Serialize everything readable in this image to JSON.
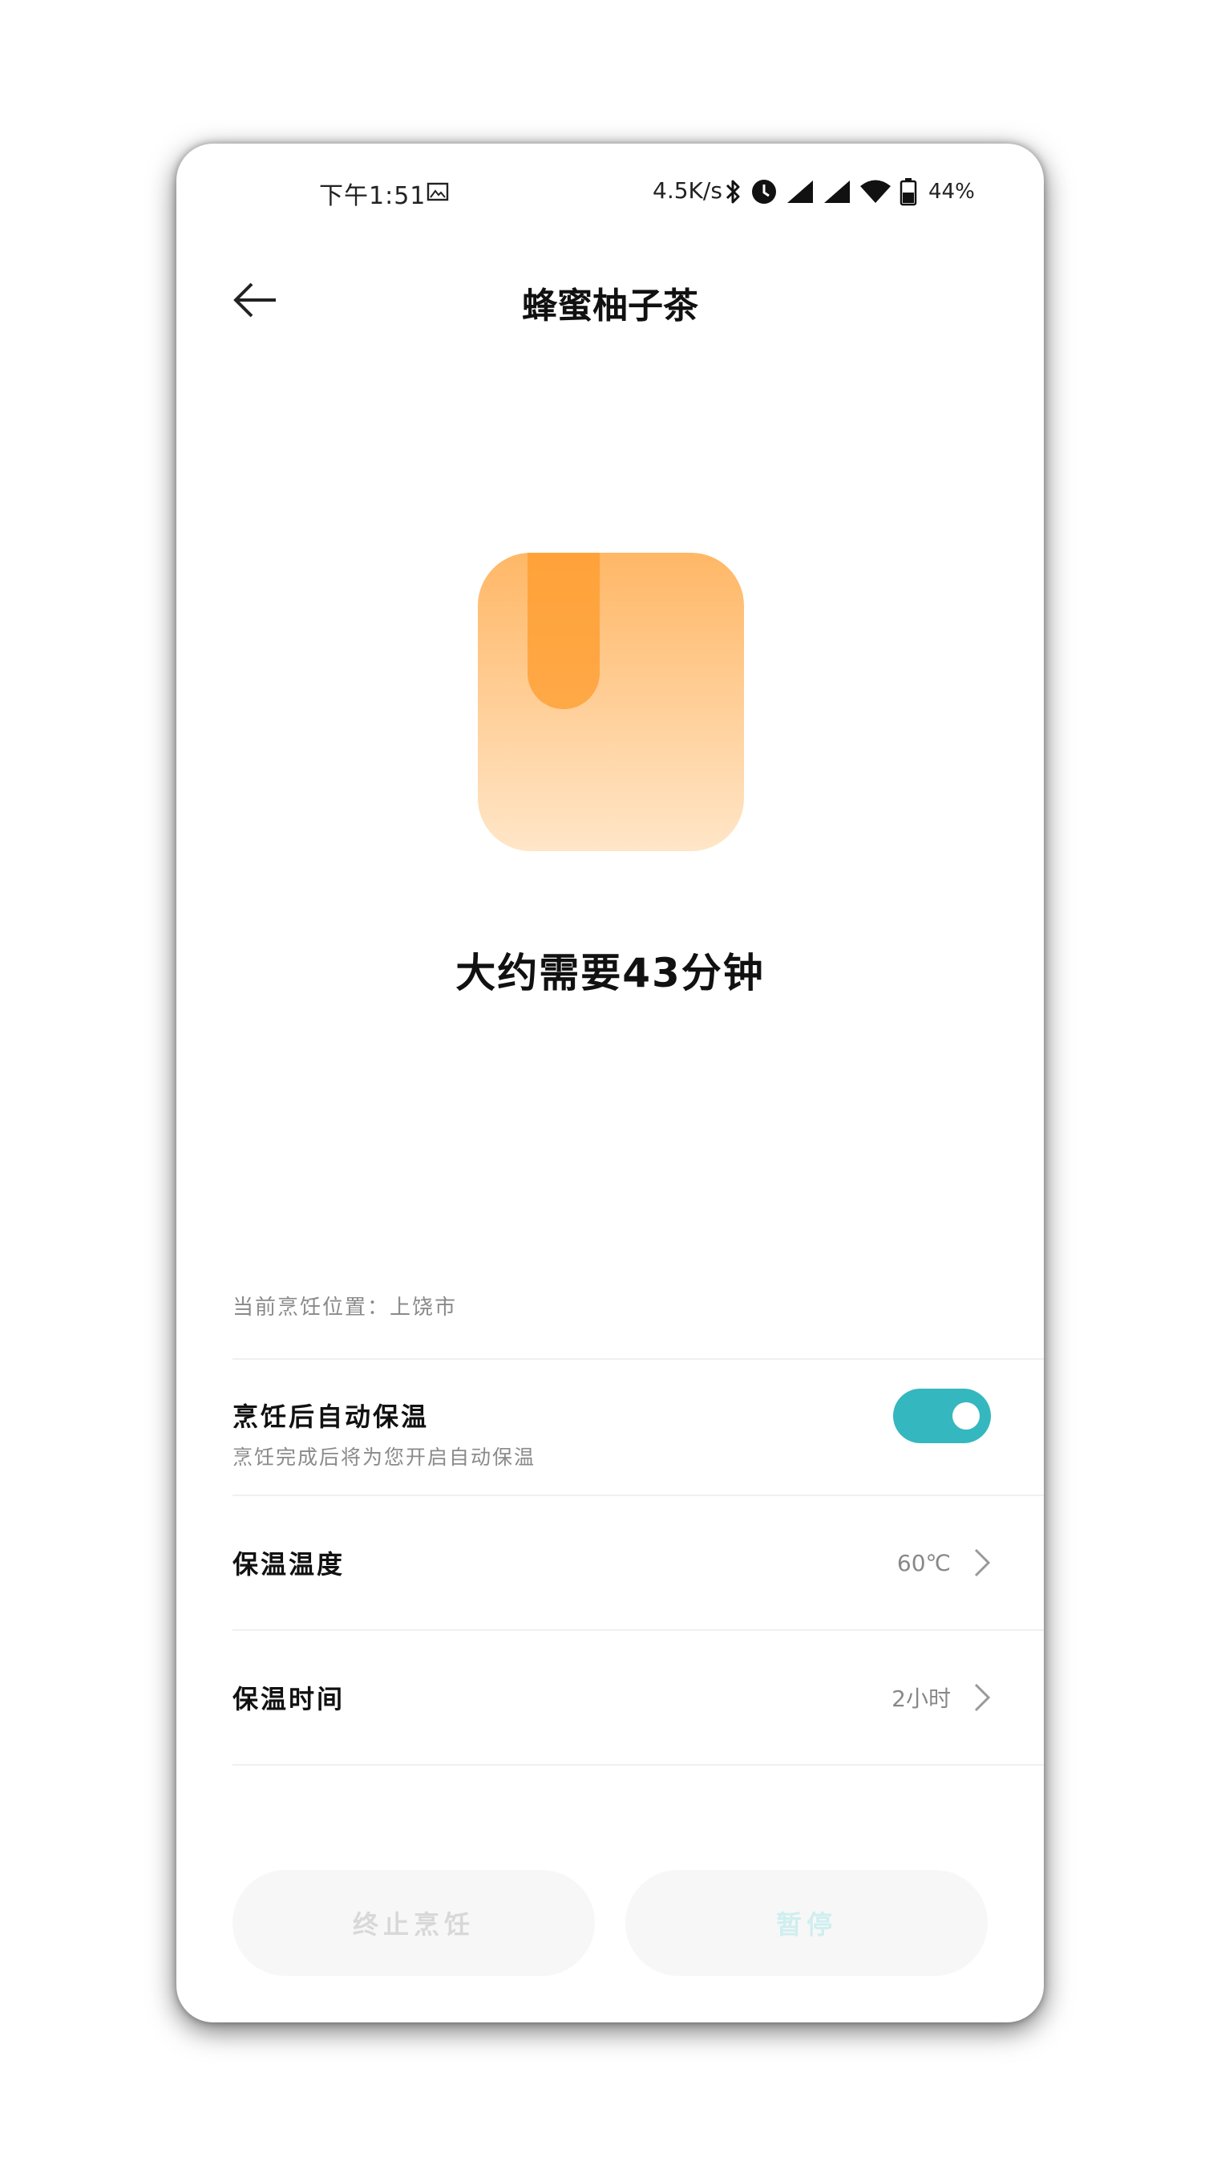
{
  "status_bar": {
    "time": "下午1:51",
    "net_speed": "4.5K/s",
    "battery": "44%"
  },
  "header": {
    "title": "蜂蜜柚子茶"
  },
  "main": {
    "estimate": "大约需要43分钟",
    "location": "当前烹饪位置：上饶市"
  },
  "settings": {
    "keep_warm": {
      "title": "烹饪后自动保温",
      "subtitle": "烹饪完成后将为您开启自动保温",
      "enabled": true
    },
    "temperature": {
      "title": "保温温度",
      "value": "60℃"
    },
    "duration": {
      "title": "保温时间",
      "value": "2小时"
    }
  },
  "actions": {
    "stop_label": "终止烹饪",
    "pause_label": "暂停"
  },
  "colors": {
    "accent": "#35b7bf",
    "illustration_top": "#ffb766",
    "illustration_bottom": "#ffe6c8",
    "bookmark": "#ff9b2b"
  }
}
